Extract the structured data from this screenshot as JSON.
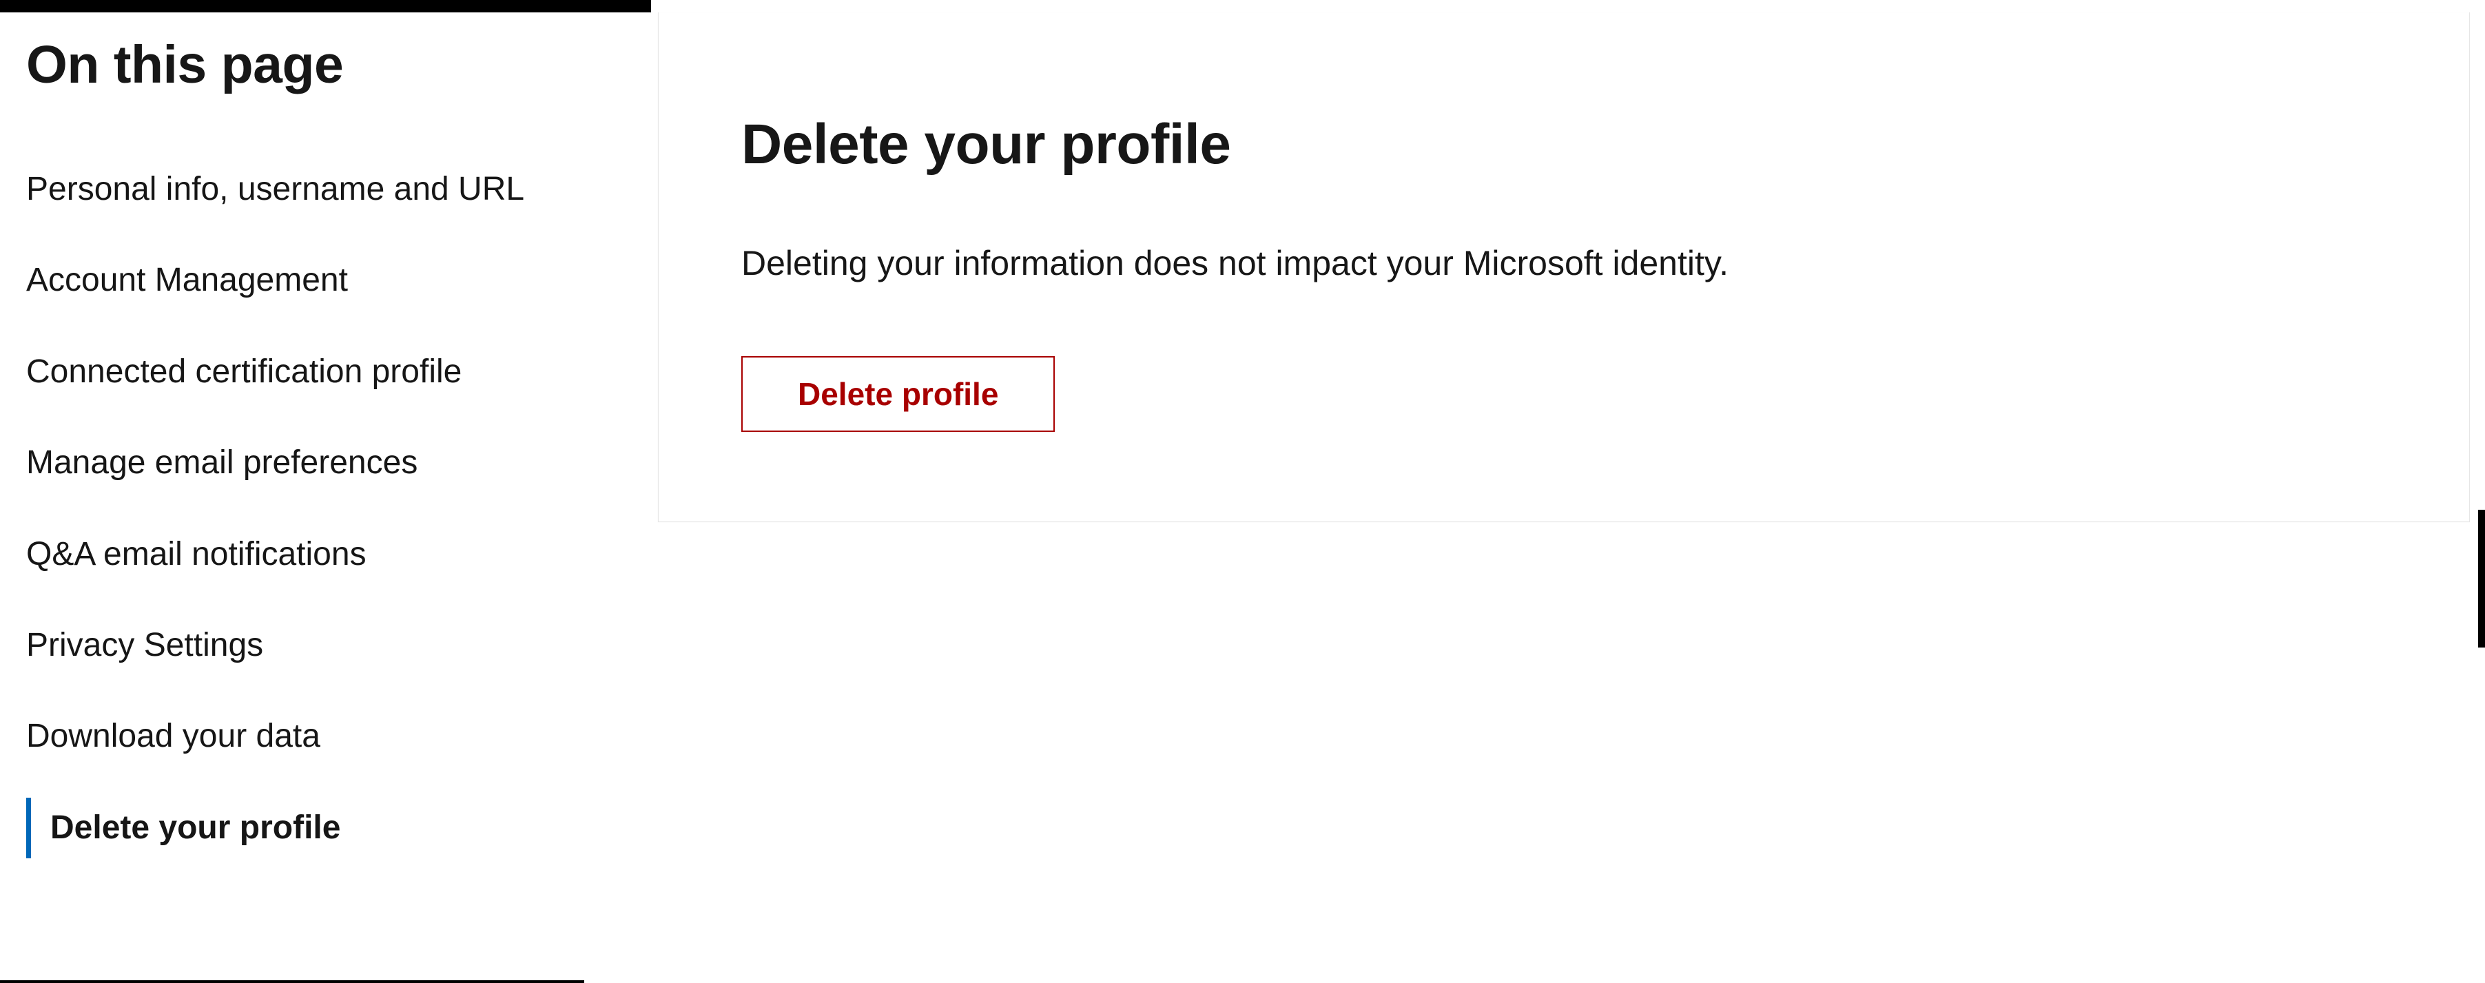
{
  "sidebar": {
    "title": "On this page",
    "items": [
      {
        "label": "Personal info, username and URL",
        "active": false
      },
      {
        "label": "Account Management",
        "active": false
      },
      {
        "label": "Connected certification profile",
        "active": false
      },
      {
        "label": "Manage email preferences",
        "active": false
      },
      {
        "label": "Q&A email notifications",
        "active": false
      },
      {
        "label": "Privacy Settings",
        "active": false
      },
      {
        "label": "Download your data",
        "active": false
      },
      {
        "label": "Delete your profile",
        "active": true
      }
    ]
  },
  "main": {
    "heading": "Delete your profile",
    "description": "Deleting your information does not impact your Microsoft identity.",
    "delete_button_label": "Delete profile"
  }
}
